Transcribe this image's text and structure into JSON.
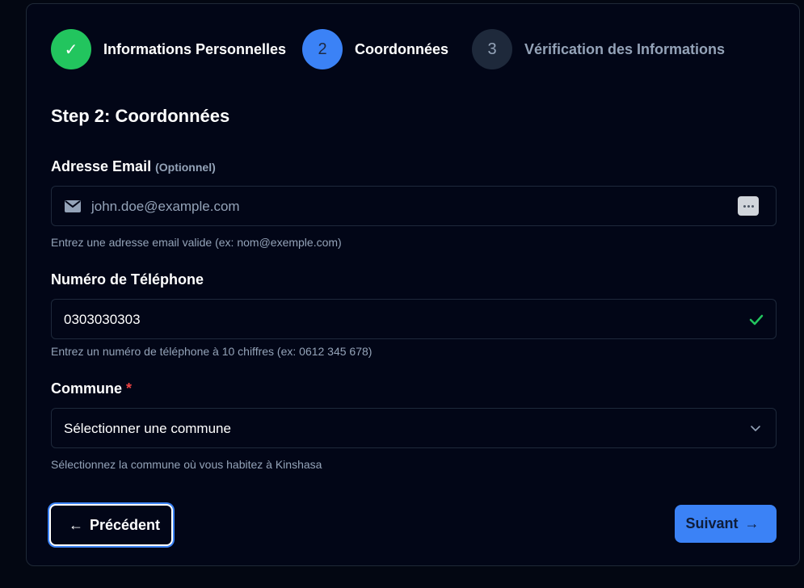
{
  "stepper": {
    "steps": [
      {
        "indicator": "✓",
        "label": "Informations Personnelles",
        "status": "completed"
      },
      {
        "indicator": "2",
        "label": "Coordonnées",
        "status": "active"
      },
      {
        "indicator": "3",
        "label": "Vérification des Informations",
        "status": "pending"
      }
    ]
  },
  "form": {
    "title": "Step 2: Coordonnées",
    "email": {
      "label": "Adresse Email",
      "optional_tag": "(Optionnel)",
      "placeholder": "john.doe@example.com",
      "value": "",
      "hint": "Entrez une adresse email valide (ex: nom@exemple.com)"
    },
    "phone": {
      "label": "Numéro de Téléphone",
      "value": "0303030303",
      "hint": "Entrez un numéro de téléphone à 10 chiffres (ex: 0612 345 678)"
    },
    "commune": {
      "label": "Commune",
      "required_mark": "*",
      "selected": "Sélectionner une commune",
      "hint": "Sélectionnez la commune où vous habitez à Kinshasa"
    }
  },
  "actions": {
    "prev_arrow": "←",
    "prev_label": "Précédent",
    "next_label": "Suivant",
    "next_arrow": "→"
  },
  "colors": {
    "completed": "#22c55e",
    "active": "#3b82f6",
    "pending": "#1e293b",
    "required": "#ef4444",
    "valid_check": "#22c55e"
  }
}
